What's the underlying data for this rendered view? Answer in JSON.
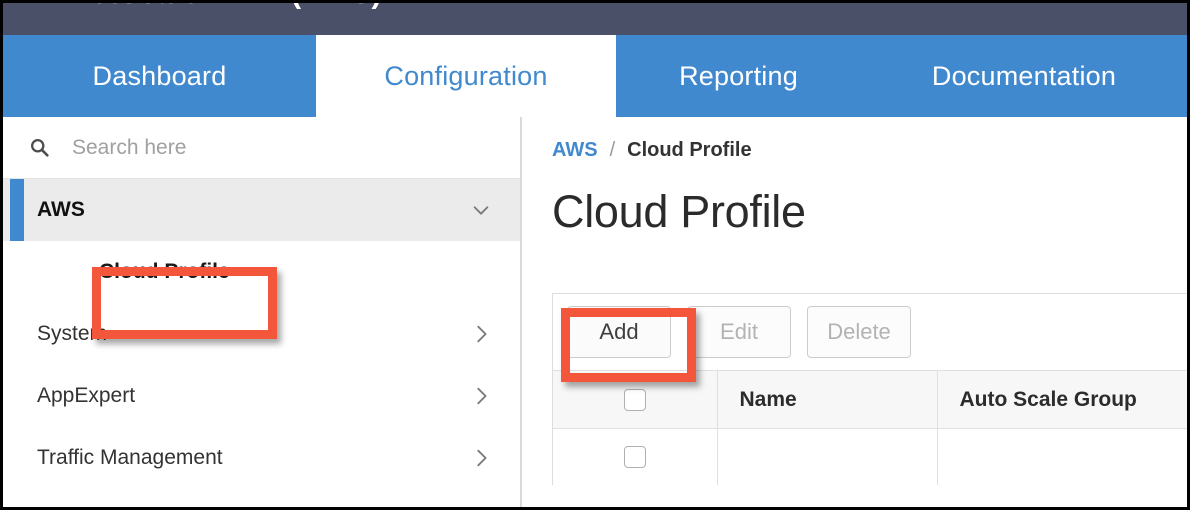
{
  "topbar": {
    "cut_text": "NetScaler VPX (AWS)"
  },
  "nav": {
    "tabs": [
      {
        "label": "Dashboard",
        "active": false
      },
      {
        "label": "Configuration",
        "active": true
      },
      {
        "label": "Reporting",
        "active": false
      },
      {
        "label": "Documentation",
        "active": false
      }
    ]
  },
  "sidebar": {
    "search": {
      "placeholder": "Search here",
      "value": "",
      "icon": "search-icon"
    },
    "items": [
      {
        "label": "AWS",
        "state": "expanded",
        "icon": "chevron-down-icon"
      },
      {
        "label": "Cloud Profile",
        "state": "child",
        "icon": ""
      },
      {
        "label": "System",
        "state": "collapsed",
        "icon": "chevron-right-icon"
      },
      {
        "label": "AppExpert",
        "state": "collapsed",
        "icon": "chevron-right-icon"
      },
      {
        "label": "Traffic Management",
        "state": "collapsed",
        "icon": "chevron-right-icon"
      }
    ]
  },
  "main": {
    "breadcrumb": {
      "root": "AWS",
      "separator": "/",
      "current": "Cloud Profile"
    },
    "title": "Cloud Profile",
    "toolbar": {
      "add_label": "Add",
      "edit_label": "Edit",
      "delete_label": "Delete"
    },
    "table": {
      "columns": [
        "",
        "Name",
        "Auto Scale Group"
      ],
      "rows": [
        {
          "checked": false,
          "name": "",
          "auto_scale_group": ""
        }
      ]
    }
  },
  "annotations": {
    "color": "#f4563c",
    "targets": [
      "Cloud Profile",
      "Add"
    ]
  },
  "colors": {
    "topbar": "#4a5067",
    "nav_blue": "#4189ce",
    "accent_red": "#f4563c",
    "sidebar_active": "#ebebeb"
  }
}
